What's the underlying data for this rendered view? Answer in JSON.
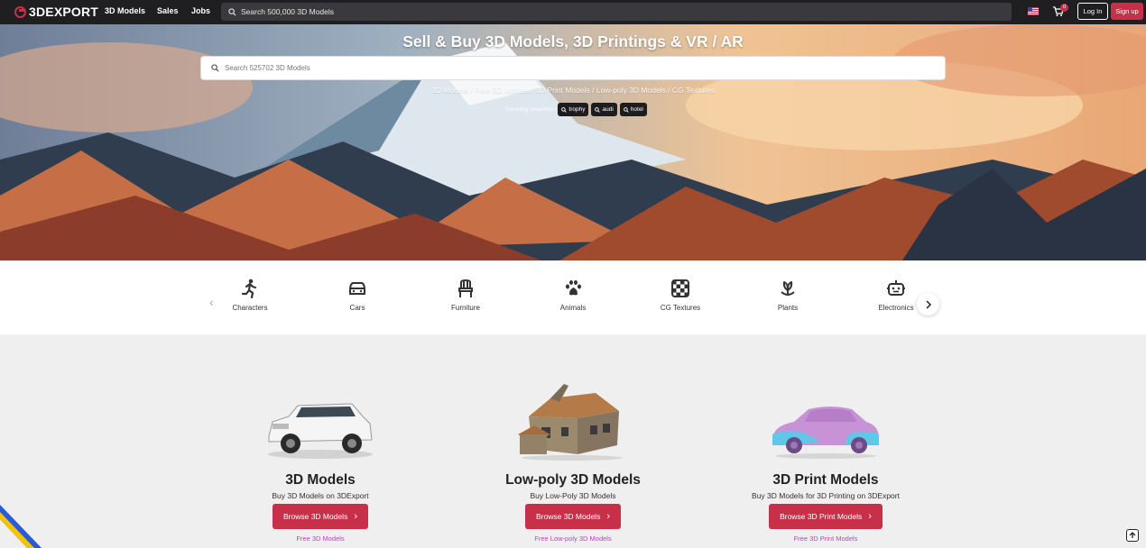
{
  "nav": {
    "logo": "3DEXPORT",
    "links": [
      "3D Models",
      "Sales",
      "Jobs"
    ],
    "search_placeholder": "Search 500,000 3D Models",
    "cart_count": "0",
    "login": "Log In",
    "signup": "Sign up"
  },
  "hero": {
    "title": "Sell & Buy 3D Models, 3D Printings & VR / AR",
    "search_placeholder": "Search 525702 3D Models",
    "links": "3D Models / Free 3D Models / 3D Print Models / Low-poly 3D Models / CG Textures",
    "trending_label": "Trending searches:",
    "trending": [
      "trophy",
      "audi",
      "hotel"
    ]
  },
  "categories": [
    {
      "label": "Characters",
      "icon": "person-running-icon"
    },
    {
      "label": "Cars",
      "icon": "car-icon"
    },
    {
      "label": "Furniture",
      "icon": "chair-icon"
    },
    {
      "label": "Animals",
      "icon": "paw-icon"
    },
    {
      "label": "CG Textures",
      "icon": "checkerboard-icon"
    },
    {
      "label": "Plants",
      "icon": "plant-icon"
    },
    {
      "label": "Electronics",
      "icon": "robot-icon"
    }
  ],
  "cards": [
    {
      "title": "3D Models",
      "subtitle": "Buy 3D Models on 3DExport",
      "button": "Browse 3D Models",
      "link": "Free 3D Models"
    },
    {
      "title": "Low-poly 3D Models",
      "subtitle": "Buy Low-Poly 3D Models",
      "button": "Browse 3D Models",
      "link": "Free Low-poly 3D Models"
    },
    {
      "title": "3D Print Models",
      "subtitle": "Buy 3D Models for 3D Printing on 3DExport",
      "button": "Browse 3D Print Models",
      "link": "Free 3D Print Models"
    }
  ],
  "colors": {
    "accent": "#c8304a",
    "nav_bg": "#1f1f22",
    "link": "#c23cc4"
  }
}
